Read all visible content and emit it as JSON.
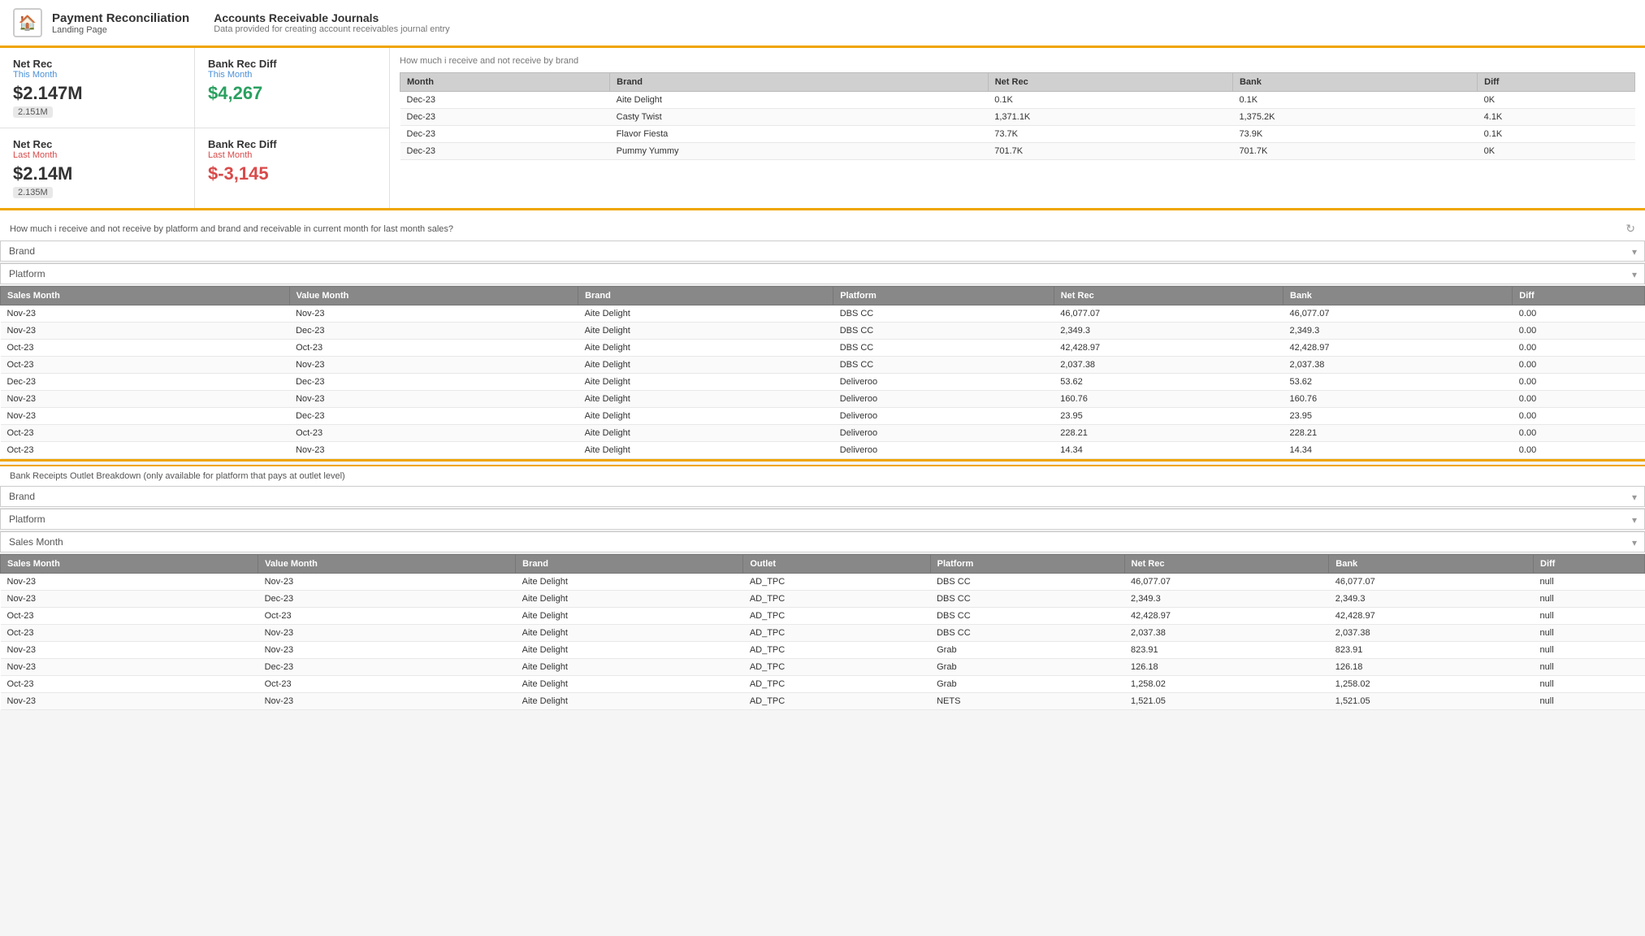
{
  "header": {
    "icon": "🏠",
    "title": "Payment Reconciliation",
    "subtitle": "Landing Page",
    "section_title": "Accounts Receivable Journals",
    "section_desc": "Data provided for creating account receivables journal entry"
  },
  "kpi": {
    "net_rec_this_label": "Net Rec",
    "net_rec_this_period": "This Month",
    "net_rec_this_value": "$2.147M",
    "net_rec_this_badge": "2.151M",
    "bank_diff_this_label": "Bank Rec Diff",
    "bank_diff_this_period": "This Month",
    "bank_diff_this_value": "$4,267",
    "net_rec_last_label": "Net Rec",
    "net_rec_last_period": "Last Month",
    "net_rec_last_value": "$2.14M",
    "net_rec_last_badge": "2.135M",
    "bank_diff_last_label": "Bank Rec Diff",
    "bank_diff_last_period": "Last Month",
    "bank_diff_last_value": "$-3,145"
  },
  "brand_table": {
    "desc": "How much i receive and not receive by brand",
    "columns": [
      "Month",
      "Brand",
      "Net Rec",
      "Bank",
      "Diff"
    ],
    "rows": [
      [
        "Dec-23",
        "Aite Delight",
        "0.1K",
        "0.1K",
        "0K"
      ],
      [
        "Dec-23",
        "Casty Twist",
        "1,371.1K",
        "1,375.2K",
        "4.1K"
      ],
      [
        "Dec-23",
        "Flavor Fiesta",
        "73.7K",
        "73.9K",
        "0.1K"
      ],
      [
        "Dec-23",
        "Pummy Yummy",
        "701.7K",
        "701.7K",
        "0K"
      ]
    ]
  },
  "platform_filter": {
    "desc": "How much i receive and not receive by platform and brand and receivable in current month for last month sales?",
    "brand_placeholder": "Brand",
    "platform_placeholder": "Platform",
    "columns": [
      "Sales Month",
      "Value Month",
      "Brand",
      "Platform",
      "Net Rec",
      "Bank",
      "Diff"
    ],
    "rows": [
      [
        "Nov-23",
        "Nov-23",
        "Aite Delight",
        "DBS CC",
        "46,077.07",
        "46,077.07",
        "0.00"
      ],
      [
        "Nov-23",
        "Dec-23",
        "Aite Delight",
        "DBS CC",
        "2,349.3",
        "2,349.3",
        "0.00"
      ],
      [
        "Oct-23",
        "Oct-23",
        "Aite Delight",
        "DBS CC",
        "42,428.97",
        "42,428.97",
        "0.00"
      ],
      [
        "Oct-23",
        "Nov-23",
        "Aite Delight",
        "DBS CC",
        "2,037.38",
        "2,037.38",
        "0.00"
      ],
      [
        "Dec-23",
        "Dec-23",
        "Aite Delight",
        "Deliveroo",
        "53.62",
        "53.62",
        "0.00"
      ],
      [
        "Nov-23",
        "Nov-23",
        "Aite Delight",
        "Deliveroo",
        "160.76",
        "160.76",
        "0.00"
      ],
      [
        "Nov-23",
        "Dec-23",
        "Aite Delight",
        "Deliveroo",
        "23.95",
        "23.95",
        "0.00"
      ],
      [
        "Oct-23",
        "Oct-23",
        "Aite Delight",
        "Deliveroo",
        "228.21",
        "228.21",
        "0.00"
      ],
      [
        "Oct-23",
        "Nov-23",
        "Aite Delight",
        "Deliveroo",
        "14.34",
        "14.34",
        "0.00"
      ]
    ]
  },
  "outlet_filter": {
    "desc": "Bank Receipts Outlet Breakdown (only available for platform that pays at outlet level)",
    "brand_placeholder": "Brand",
    "platform_placeholder": "Platform",
    "sales_month_placeholder": "Sales Month",
    "columns": [
      "Sales Month",
      "Value Month",
      "Brand",
      "Outlet",
      "Platform",
      "Net Rec",
      "Bank",
      "Diff"
    ],
    "rows": [
      [
        "Nov-23",
        "Nov-23",
        "Aite Delight",
        "AD_TPC",
        "DBS CC",
        "46,077.07",
        "46,077.07",
        "null"
      ],
      [
        "Nov-23",
        "Dec-23",
        "Aite Delight",
        "AD_TPC",
        "DBS CC",
        "2,349.3",
        "2,349.3",
        "null"
      ],
      [
        "Oct-23",
        "Oct-23",
        "Aite Delight",
        "AD_TPC",
        "DBS CC",
        "42,428.97",
        "42,428.97",
        "null"
      ],
      [
        "Oct-23",
        "Nov-23",
        "Aite Delight",
        "AD_TPC",
        "DBS CC",
        "2,037.38",
        "2,037.38",
        "null"
      ],
      [
        "Nov-23",
        "Nov-23",
        "Aite Delight",
        "AD_TPC",
        "Grab",
        "823.91",
        "823.91",
        "null"
      ],
      [
        "Nov-23",
        "Dec-23",
        "Aite Delight",
        "AD_TPC",
        "Grab",
        "126.18",
        "126.18",
        "null"
      ],
      [
        "Oct-23",
        "Oct-23",
        "Aite Delight",
        "AD_TPC",
        "Grab",
        "1,258.02",
        "1,258.02",
        "null"
      ],
      [
        "Nov-23",
        "Nov-23",
        "Aite Delight",
        "AD_TPC",
        "NETS",
        "1,521.05",
        "1,521.05",
        "null"
      ]
    ]
  }
}
